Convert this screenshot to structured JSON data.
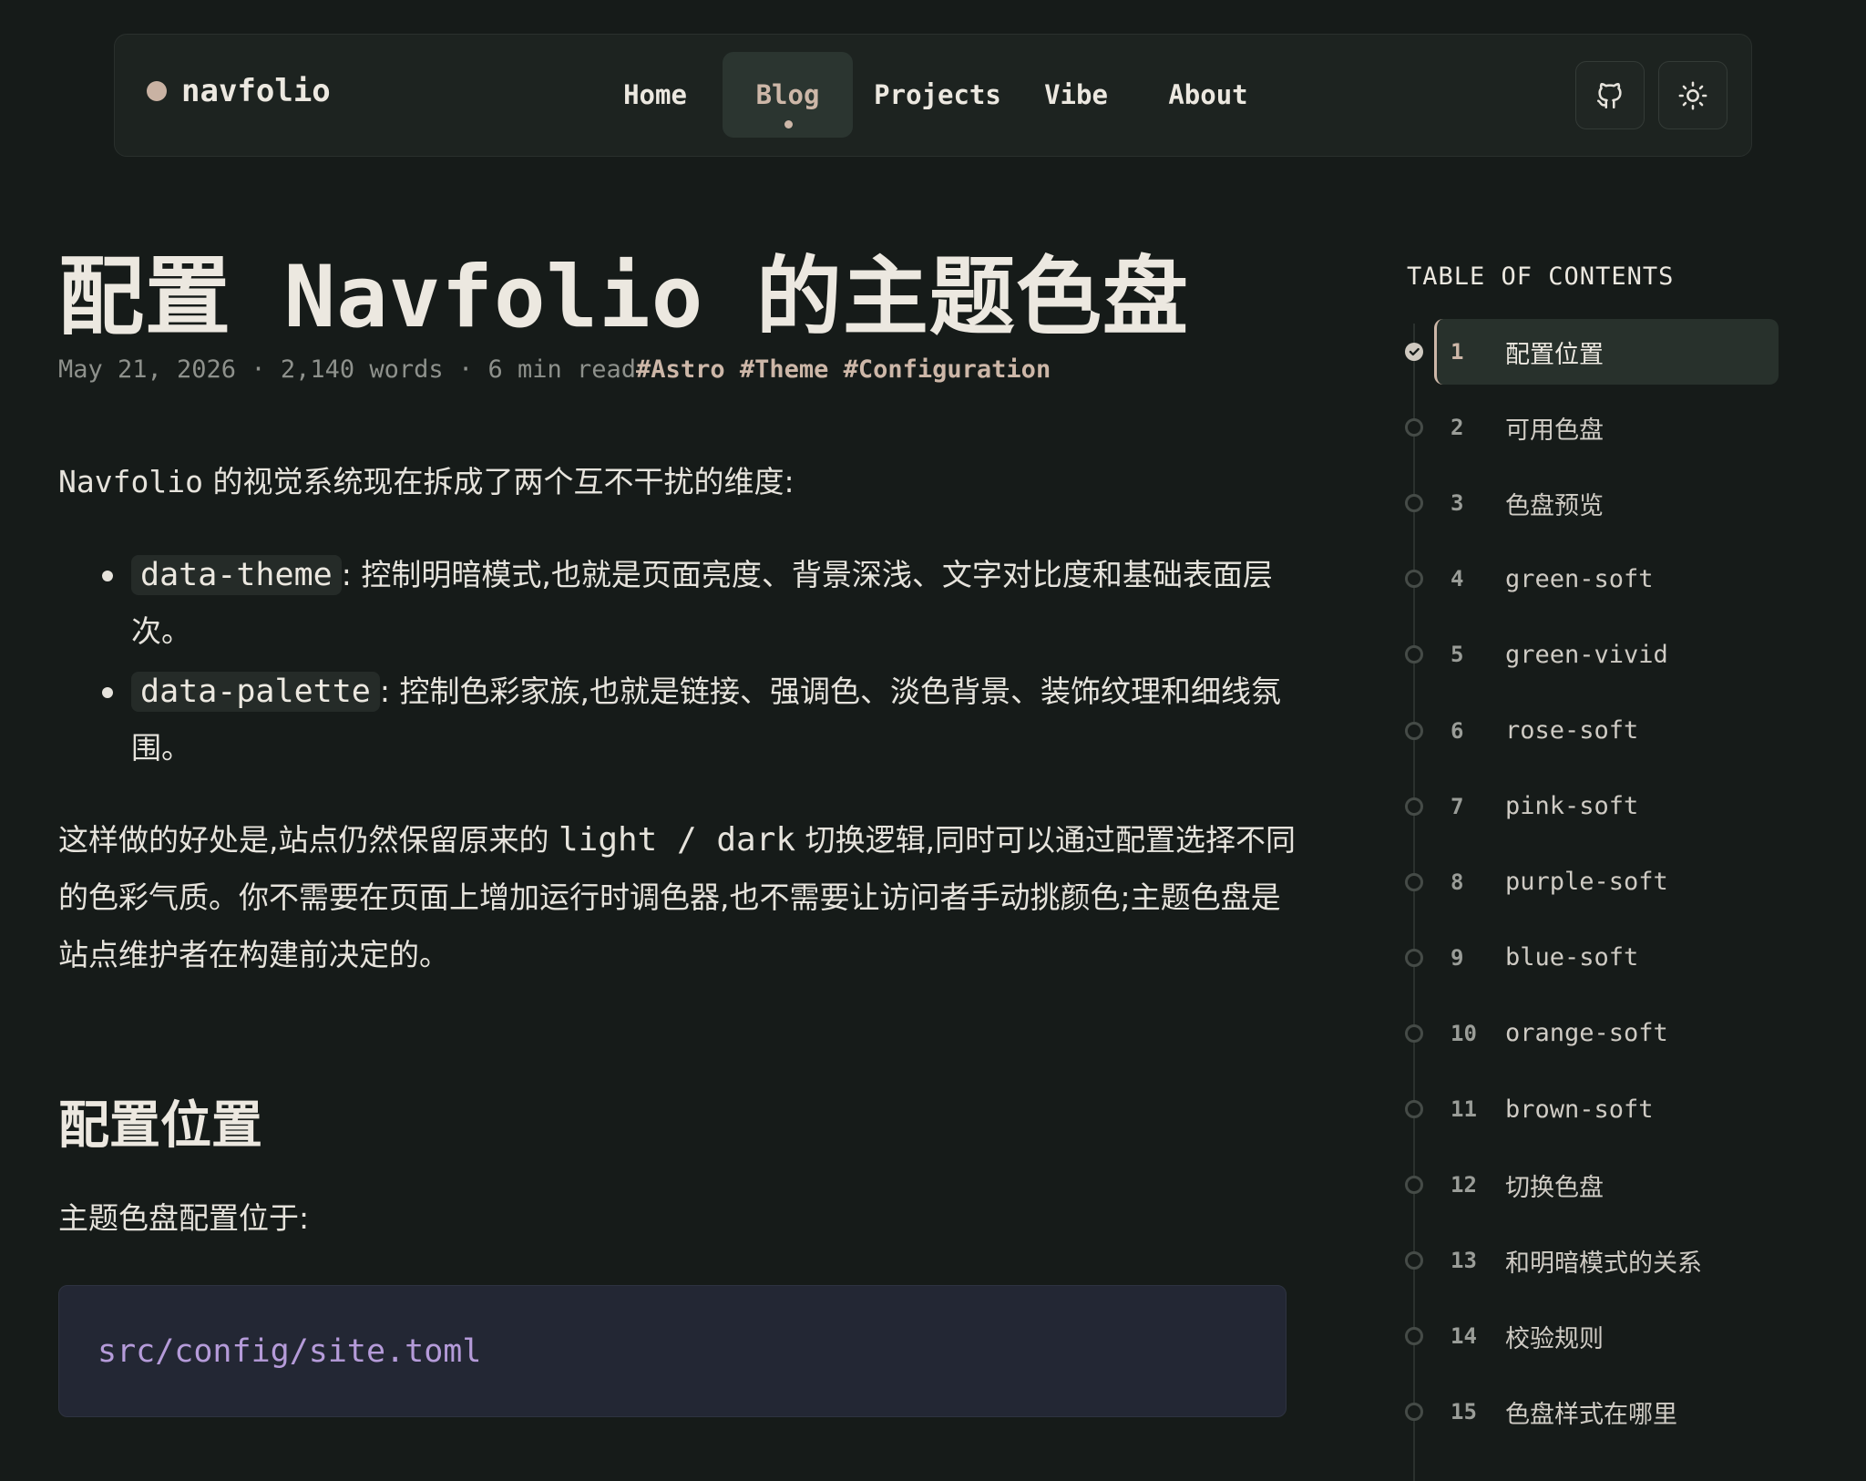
{
  "brand": {
    "name": "navfolio"
  },
  "nav": {
    "links": [
      {
        "label": "Home"
      },
      {
        "label": "Blog"
      },
      {
        "label": "Projects"
      },
      {
        "label": "Vibe"
      },
      {
        "label": "About"
      }
    ],
    "active": "Blog",
    "icons": [
      "github-icon",
      "sun-icon"
    ]
  },
  "article": {
    "title": "配置 Navfolio 的主题色盘",
    "meta": {
      "date": "May 21, 2026",
      "separator": "·",
      "words": "2,140 words",
      "read_time": "6 min read",
      "tags": "#Astro #Theme #Configuration"
    },
    "intro": {
      "mono": "Navfolio",
      "text": " 的视觉系统现在拆成了两个互不干扰的维度:"
    },
    "bullets": [
      {
        "code": "data-theme",
        "text": ": 控制明暗模式,也就是页面亮度、背景深浅、文字对比度和基础表面层次。"
      },
      {
        "code": "data-palette",
        "text": ": 控制色彩家族,也就是链接、强调色、淡色背景、装饰纹理和细线氛围。"
      }
    ],
    "para2": {
      "before": "这样做的好处是,站点仍然保留原来的 ",
      "mono": "light / dark",
      "after": " 切换逻辑,同时可以通过配置选择不同的色彩气质。你不需要在页面上增加运行时调色器,也不需要让访问者手动挑颜色;主题色盘是站点维护者在构建前决定的。"
    },
    "section_heading": "配置位置",
    "para3": "主题色盘配置位于:",
    "code_block": "src/config/site.toml"
  },
  "toc": {
    "title": "TABLE OF CONTENTS",
    "active_index": 0,
    "items": [
      {
        "num": "1",
        "label": "配置位置"
      },
      {
        "num": "2",
        "label": "可用色盘"
      },
      {
        "num": "3",
        "label": "色盘预览"
      },
      {
        "num": "4",
        "label": "green-soft"
      },
      {
        "num": "5",
        "label": "green-vivid"
      },
      {
        "num": "6",
        "label": "rose-soft"
      },
      {
        "num": "7",
        "label": "pink-soft"
      },
      {
        "num": "8",
        "label": "purple-soft"
      },
      {
        "num": "9",
        "label": "blue-soft"
      },
      {
        "num": "10",
        "label": "orange-soft"
      },
      {
        "num": "11",
        "label": "brown-soft"
      },
      {
        "num": "12",
        "label": "切换色盘"
      },
      {
        "num": "13",
        "label": "和明暗模式的关系"
      },
      {
        "num": "14",
        "label": "校验规则"
      },
      {
        "num": "15",
        "label": "色盘样式在哪里"
      }
    ]
  },
  "colors": {
    "background": "#161b19",
    "accent": "#cdb7a8",
    "code_text": "#b59bd9"
  }
}
